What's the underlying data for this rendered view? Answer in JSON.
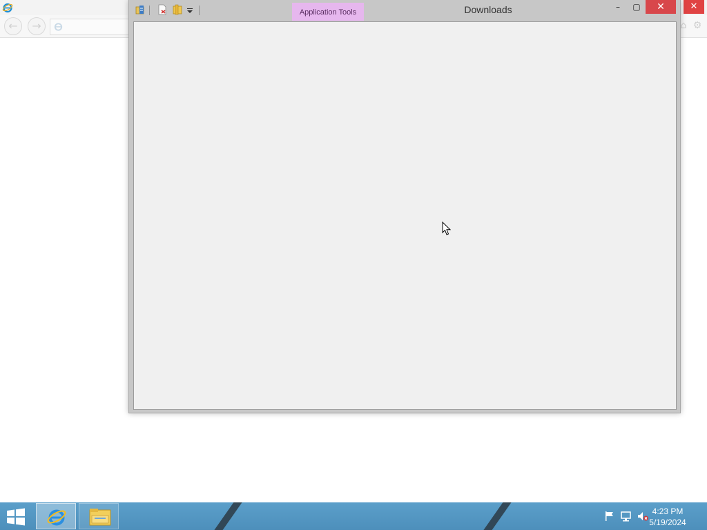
{
  "browser": {
    "close_glyph": "✕",
    "icons": [
      "ie-logo-icon",
      "back-arrow-icon",
      "forward-arrow-icon",
      "home-icon",
      "favorites-star-icon",
      "gear-icon"
    ]
  },
  "explorer": {
    "title": "Downloads",
    "context_tab": "Application Tools",
    "minimize_glyph": "–",
    "maximize_glyph": "▢",
    "close_glyph": "✕",
    "quick_access_icons": [
      "properties-icon",
      "new-document-icon",
      "new-folder-icon",
      "customize-dropdown-icon"
    ]
  },
  "taskbar": {
    "pinned": [
      "internet-explorer",
      "file-explorer"
    ],
    "tray_icons": [
      "action-center-flag-icon",
      "network-icon",
      "volume-muted-icon"
    ],
    "clock_time": "4:23 PM",
    "clock_date": "5/19/2024"
  },
  "colors": {
    "taskbar": "#5b9fca",
    "context_tab": "#e6b7ee",
    "close_button": "#d8474b",
    "window_frame": "#c7c7c7",
    "content_area": "#f0f0f0"
  }
}
